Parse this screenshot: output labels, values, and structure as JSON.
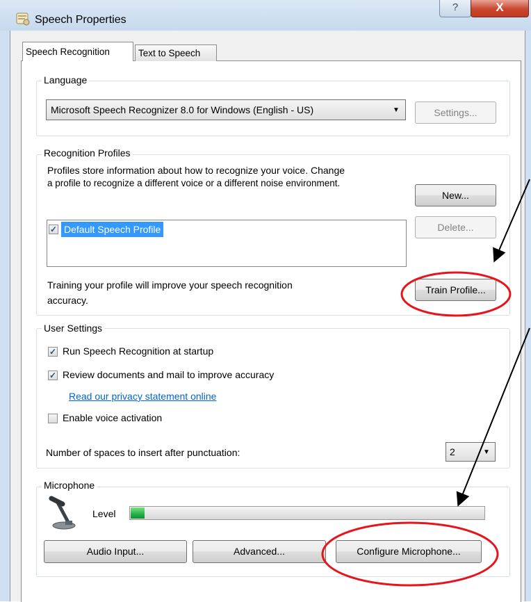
{
  "window": {
    "title": "Speech Properties",
    "help_glyph": "?",
    "close_glyph": "X"
  },
  "tabs": [
    {
      "label": "Speech Recognition"
    },
    {
      "label": "Text to Speech"
    }
  ],
  "language": {
    "group_label": "Language",
    "recognizer_value": "Microsoft Speech Recognizer 8.0 for Windows (English - US)",
    "settings_label": "Settings..."
  },
  "profiles": {
    "group_label": "Recognition Profiles",
    "description_line1": "Profiles store information about how to recognize your voice.  Change",
    "description_line2": "a profile to recognize a different voice or a different noise environment.",
    "new_label": "New...",
    "delete_label": "Delete...",
    "items": [
      {
        "name": "Default Speech Profile",
        "checked": true
      }
    ],
    "training_line1": "Training your profile will improve your speech recognition",
    "training_line2": "accuracy.",
    "train_label": "Train Profile..."
  },
  "user_settings": {
    "group_label": "User Settings",
    "run_at_startup": {
      "label": "Run Speech Recognition at startup",
      "checked": true
    },
    "review_documents": {
      "label": "Review documents and mail to improve accuracy",
      "checked": true
    },
    "privacy_link": "Read our privacy statement online",
    "voice_activation": {
      "label": "Enable voice activation",
      "checked": false
    },
    "spaces_label": "Number of spaces to insert after punctuation:",
    "spaces_value": "2"
  },
  "microphone": {
    "group_label": "Microphone",
    "level_label": "Level",
    "level_fraction": 0.04,
    "audio_input_label": "Audio Input...",
    "advanced_label": "Advanced...",
    "configure_label": "Configure Microphone..."
  },
  "colors": {
    "annotation": "#e8141b",
    "level_fill": "#22b14c",
    "selection": "#3399ff"
  }
}
